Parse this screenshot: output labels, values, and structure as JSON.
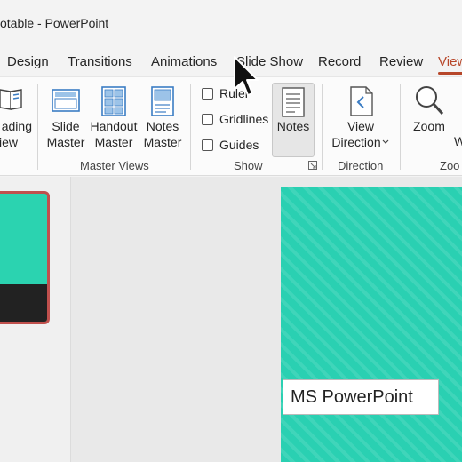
{
  "app": {
    "title": "otable  -  PowerPoint"
  },
  "tabs": [
    {
      "label": "Design"
    },
    {
      "label": "Transitions"
    },
    {
      "label": "Animations"
    },
    {
      "label": "Slide Show"
    },
    {
      "label": "Record"
    },
    {
      "label": "Review"
    },
    {
      "label": "View"
    }
  ],
  "ribbon": {
    "reading_view": {
      "line1": "ading",
      "line2": "iew"
    },
    "slide_master": {
      "line1": "Slide",
      "line2": "Master"
    },
    "handout_master": {
      "line1": "Handout",
      "line2": "Master"
    },
    "notes_master": {
      "line1": "Notes",
      "line2": "Master"
    },
    "master_views_group": "Master Views",
    "show": {
      "ruler": "Ruler",
      "gridlines": "Gridlines",
      "guides": "Guides",
      "notes": "Notes",
      "group": "Show"
    },
    "view_direction": {
      "line1": "View",
      "line2": "Direction"
    },
    "direction_group": "Direction",
    "zoom": {
      "label": "Zoom",
      "partial": "W",
      "group": "Zoo"
    }
  },
  "slide": {
    "text": "MS PowerPoint"
  },
  "colors": {
    "accent": "#b7472a",
    "slide_bg": "#2ad0b2",
    "thumb_border": "#c0504d"
  }
}
